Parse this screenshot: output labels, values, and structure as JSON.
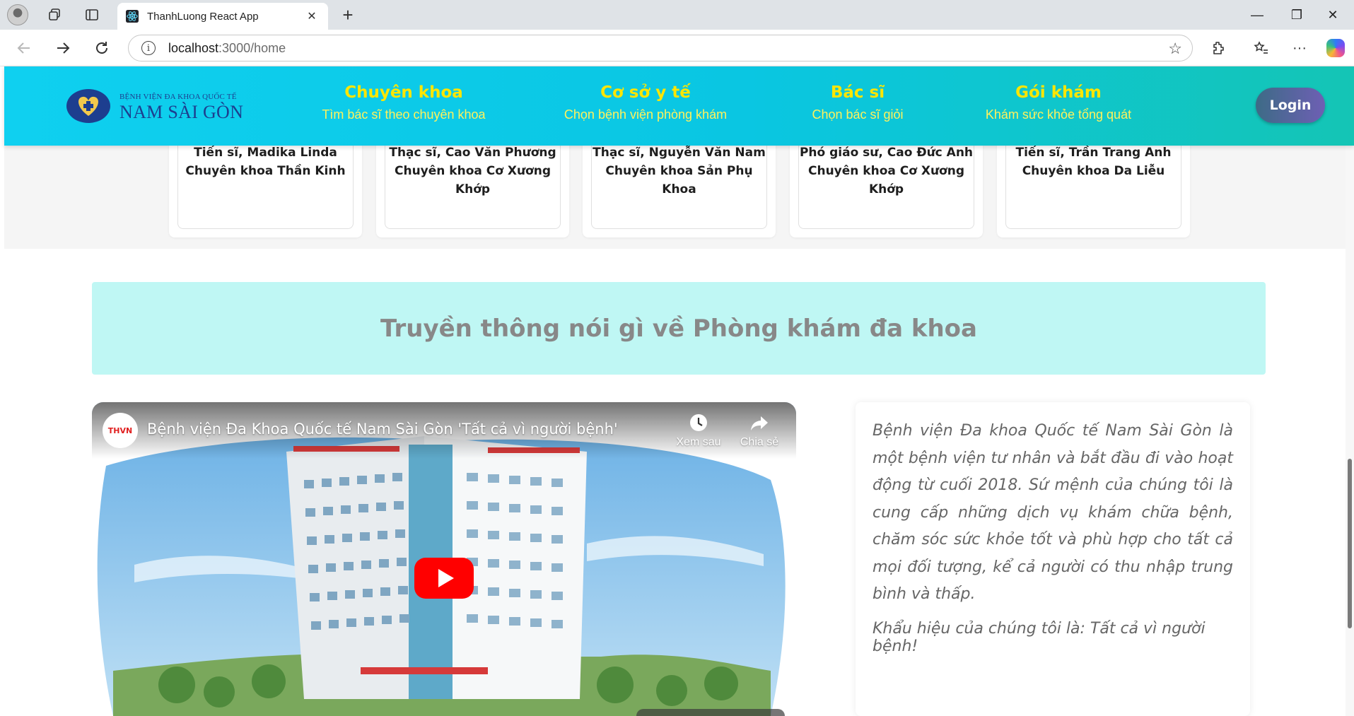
{
  "browser": {
    "tab_title": "ThanhLuong React App",
    "tab_close": "✕",
    "new_tab": "+",
    "url_host": "localhost",
    "url_path": ":3000/home",
    "window_controls": {
      "minimize": "—",
      "restore": "❐",
      "close": "✕"
    }
  },
  "header": {
    "logo_small": "BỆNH VIỆN ĐA KHOA QUỐC TẾ",
    "logo_big": "NAM SÀI GÒN",
    "menu": [
      {
        "title": "Chuyên khoa",
        "subtitle": "Tìm bác sĩ theo chuyên khoa"
      },
      {
        "title": "Cơ sở y tế",
        "subtitle": "Chọn bệnh viện phòng khám"
      },
      {
        "title": "Bác sĩ",
        "subtitle": "Chọn bác sĩ giỏi"
      },
      {
        "title": "Gói khám",
        "subtitle": "Khám sức khỏe tổng quát"
      }
    ],
    "login_label": "Login"
  },
  "doctors": [
    {
      "name": "Tiến sĩ, Madika Linda",
      "specialty": "Chuyên khoa Thần Kinh"
    },
    {
      "name": "Thạc sĩ, Cao Văn Phương",
      "specialty": "Chuyên khoa Cơ Xương Khớp"
    },
    {
      "name": "Thạc sĩ, Nguyễn Văn Nam",
      "specialty": "Chuyên khoa Sản Phụ Khoa"
    },
    {
      "name": "Phó giáo sư, Cao Đức Anh",
      "specialty": "Chuyên khoa Cơ Xương Khớp"
    },
    {
      "name": "Tiến sĩ, Trần Trang Anh",
      "specialty": "Chuyên khoa Da Liễu"
    }
  ],
  "media": {
    "title": "Truyền thông nói gì về Phòng khám đa khoa",
    "video": {
      "channel_logo": "THVN",
      "title": "Bệnh viện Đa Khoa Quốc tế Nam Sài Gòn 'Tất cả vì người bệnh'",
      "watch_later": "Xem sau",
      "share": "Chia sẻ"
    },
    "description": "Bệnh viện Đa khoa Quốc tế Nam Sài Gòn là một bệnh viện tư nhân và bắt đầu đi vào hoạt động từ cuối 2018. Sứ mệnh của chúng tôi là cung cấp những dịch vụ khám chữa bệnh, chăm sóc sức khỏe tốt và phù hợp cho tất cả mọi đối tượng, kể cả người có thu nhập trung bình và thấp.",
    "slogan": "Khẩu hiệu của chúng tôi là: Tất cả vì người bệnh!"
  },
  "colors": {
    "header_gradient_start": "#0fd0f0",
    "header_gradient_end": "#14c5b5",
    "menu_title": "#ffe600",
    "media_title_bg": "#bff7f4",
    "play_button": "#ff0000"
  }
}
